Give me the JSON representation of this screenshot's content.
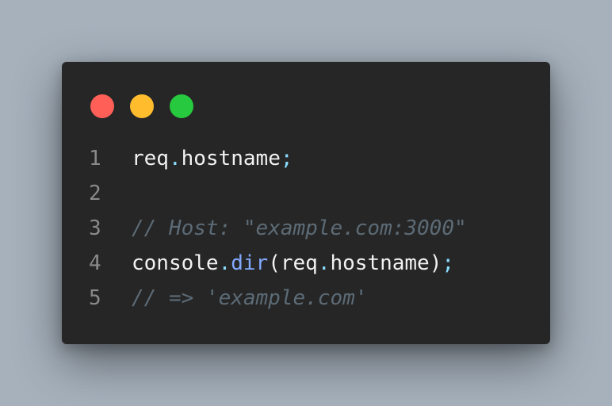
{
  "window": {
    "dots": [
      {
        "name": "close",
        "color": "#ff5f56"
      },
      {
        "name": "minimize",
        "color": "#ffbd2e"
      },
      {
        "name": "maximize",
        "color": "#27c93f"
      }
    ]
  },
  "code": {
    "lines": [
      {
        "number": "1",
        "tokens": [
          {
            "text": "req",
            "kind": "plain"
          },
          {
            "text": ".",
            "kind": "punc"
          },
          {
            "text": "hostname",
            "kind": "plain"
          },
          {
            "text": ";",
            "kind": "punc"
          }
        ]
      },
      {
        "number": "2",
        "tokens": []
      },
      {
        "number": "3",
        "tokens": [
          {
            "text": "// Host: \"example.com:3000\"",
            "kind": "comment"
          }
        ]
      },
      {
        "number": "4",
        "tokens": [
          {
            "text": "console",
            "kind": "plain"
          },
          {
            "text": ".",
            "kind": "punc"
          },
          {
            "text": "dir",
            "kind": "fn"
          },
          {
            "text": "(req",
            "kind": "plain"
          },
          {
            "text": ".",
            "kind": "punc"
          },
          {
            "text": "hostname)",
            "kind": "plain"
          },
          {
            "text": ";",
            "kind": "punc"
          }
        ]
      },
      {
        "number": "5",
        "tokens": [
          {
            "text": "// => 'example.com'",
            "kind": "comment"
          }
        ]
      }
    ]
  }
}
